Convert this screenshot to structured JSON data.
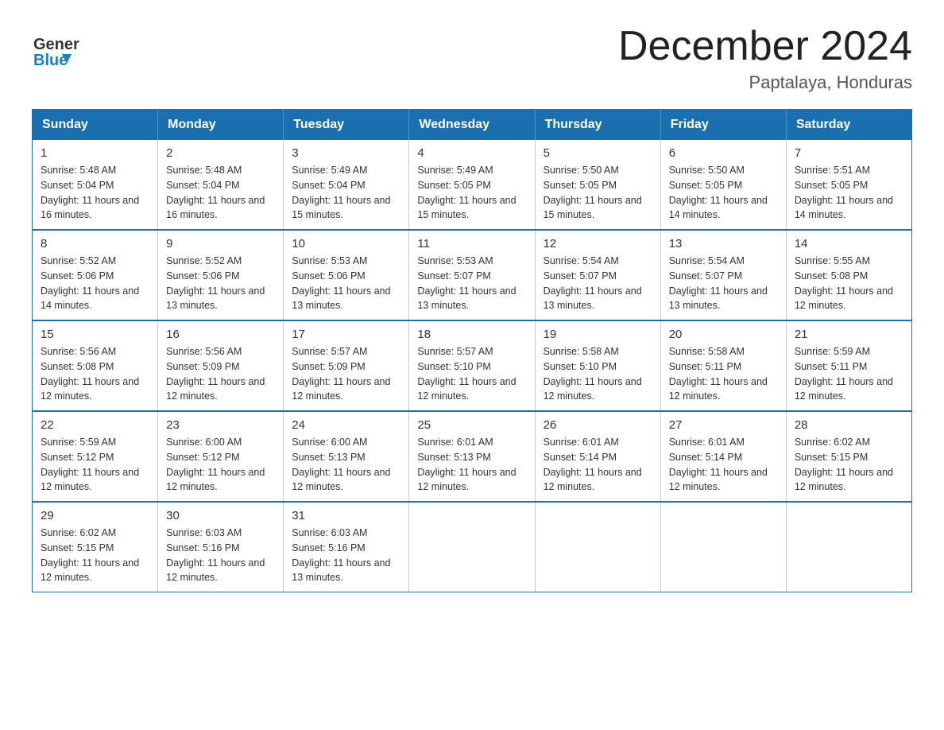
{
  "header": {
    "logo_general": "General",
    "logo_blue": "Blue",
    "title": "December 2024",
    "subtitle": "Paptalaya, Honduras"
  },
  "days_of_week": [
    "Sunday",
    "Monday",
    "Tuesday",
    "Wednesday",
    "Thursday",
    "Friday",
    "Saturday"
  ],
  "weeks": [
    [
      {
        "day": "1",
        "sunrise": "5:48 AM",
        "sunset": "5:04 PM",
        "daylight": "11 hours and 16 minutes."
      },
      {
        "day": "2",
        "sunrise": "5:48 AM",
        "sunset": "5:04 PM",
        "daylight": "11 hours and 16 minutes."
      },
      {
        "day": "3",
        "sunrise": "5:49 AM",
        "sunset": "5:04 PM",
        "daylight": "11 hours and 15 minutes."
      },
      {
        "day": "4",
        "sunrise": "5:49 AM",
        "sunset": "5:05 PM",
        "daylight": "11 hours and 15 minutes."
      },
      {
        "day": "5",
        "sunrise": "5:50 AM",
        "sunset": "5:05 PM",
        "daylight": "11 hours and 15 minutes."
      },
      {
        "day": "6",
        "sunrise": "5:50 AM",
        "sunset": "5:05 PM",
        "daylight": "11 hours and 14 minutes."
      },
      {
        "day": "7",
        "sunrise": "5:51 AM",
        "sunset": "5:05 PM",
        "daylight": "11 hours and 14 minutes."
      }
    ],
    [
      {
        "day": "8",
        "sunrise": "5:52 AM",
        "sunset": "5:06 PM",
        "daylight": "11 hours and 14 minutes."
      },
      {
        "day": "9",
        "sunrise": "5:52 AM",
        "sunset": "5:06 PM",
        "daylight": "11 hours and 13 minutes."
      },
      {
        "day": "10",
        "sunrise": "5:53 AM",
        "sunset": "5:06 PM",
        "daylight": "11 hours and 13 minutes."
      },
      {
        "day": "11",
        "sunrise": "5:53 AM",
        "sunset": "5:07 PM",
        "daylight": "11 hours and 13 minutes."
      },
      {
        "day": "12",
        "sunrise": "5:54 AM",
        "sunset": "5:07 PM",
        "daylight": "11 hours and 13 minutes."
      },
      {
        "day": "13",
        "sunrise": "5:54 AM",
        "sunset": "5:07 PM",
        "daylight": "11 hours and 13 minutes."
      },
      {
        "day": "14",
        "sunrise": "5:55 AM",
        "sunset": "5:08 PM",
        "daylight": "11 hours and 12 minutes."
      }
    ],
    [
      {
        "day": "15",
        "sunrise": "5:56 AM",
        "sunset": "5:08 PM",
        "daylight": "11 hours and 12 minutes."
      },
      {
        "day": "16",
        "sunrise": "5:56 AM",
        "sunset": "5:09 PM",
        "daylight": "11 hours and 12 minutes."
      },
      {
        "day": "17",
        "sunrise": "5:57 AM",
        "sunset": "5:09 PM",
        "daylight": "11 hours and 12 minutes."
      },
      {
        "day": "18",
        "sunrise": "5:57 AM",
        "sunset": "5:10 PM",
        "daylight": "11 hours and 12 minutes."
      },
      {
        "day": "19",
        "sunrise": "5:58 AM",
        "sunset": "5:10 PM",
        "daylight": "11 hours and 12 minutes."
      },
      {
        "day": "20",
        "sunrise": "5:58 AM",
        "sunset": "5:11 PM",
        "daylight": "11 hours and 12 minutes."
      },
      {
        "day": "21",
        "sunrise": "5:59 AM",
        "sunset": "5:11 PM",
        "daylight": "11 hours and 12 minutes."
      }
    ],
    [
      {
        "day": "22",
        "sunrise": "5:59 AM",
        "sunset": "5:12 PM",
        "daylight": "11 hours and 12 minutes."
      },
      {
        "day": "23",
        "sunrise": "6:00 AM",
        "sunset": "5:12 PM",
        "daylight": "11 hours and 12 minutes."
      },
      {
        "day": "24",
        "sunrise": "6:00 AM",
        "sunset": "5:13 PM",
        "daylight": "11 hours and 12 minutes."
      },
      {
        "day": "25",
        "sunrise": "6:01 AM",
        "sunset": "5:13 PM",
        "daylight": "11 hours and 12 minutes."
      },
      {
        "day": "26",
        "sunrise": "6:01 AM",
        "sunset": "5:14 PM",
        "daylight": "11 hours and 12 minutes."
      },
      {
        "day": "27",
        "sunrise": "6:01 AM",
        "sunset": "5:14 PM",
        "daylight": "11 hours and 12 minutes."
      },
      {
        "day": "28",
        "sunrise": "6:02 AM",
        "sunset": "5:15 PM",
        "daylight": "11 hours and 12 minutes."
      }
    ],
    [
      {
        "day": "29",
        "sunrise": "6:02 AM",
        "sunset": "5:15 PM",
        "daylight": "11 hours and 12 minutes."
      },
      {
        "day": "30",
        "sunrise": "6:03 AM",
        "sunset": "5:16 PM",
        "daylight": "11 hours and 12 minutes."
      },
      {
        "day": "31",
        "sunrise": "6:03 AM",
        "sunset": "5:16 PM",
        "daylight": "11 hours and 13 minutes."
      },
      null,
      null,
      null,
      null
    ]
  ]
}
